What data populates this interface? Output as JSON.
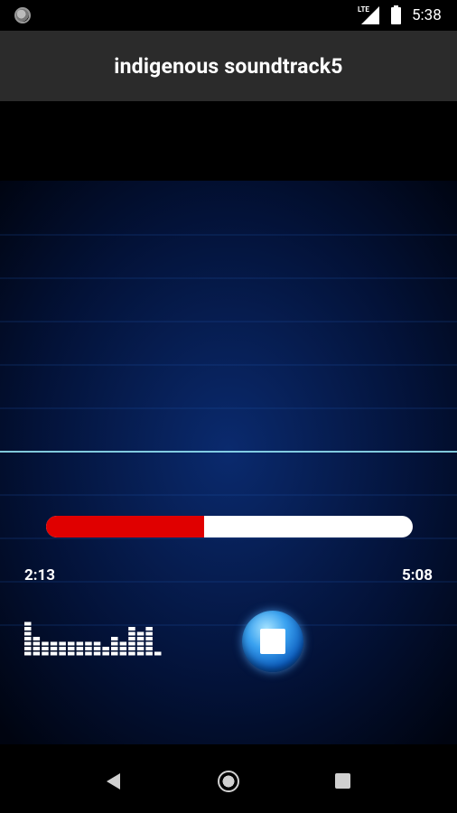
{
  "status_bar": {
    "network_label": "LTE",
    "time": "5:38"
  },
  "app_bar": {
    "title": "indigenous soundtrack5"
  },
  "player": {
    "current_time": "2:13",
    "total_time": "5:08",
    "progress_fraction": 0.43,
    "progress_color": "#e00000",
    "track_color": "#ffffff"
  },
  "icons": {
    "status_left": "circle-notification-icon",
    "signal": "signal-icon",
    "battery": "battery-icon",
    "equalizer": "equalizer-icon",
    "stop": "stop-icon",
    "back": "back-icon",
    "home": "home-icon",
    "recent": "recent-apps-icon"
  },
  "colors": {
    "app_bar": "#2b2b2b",
    "background": "#000000",
    "wave": "#1ec8e8"
  }
}
